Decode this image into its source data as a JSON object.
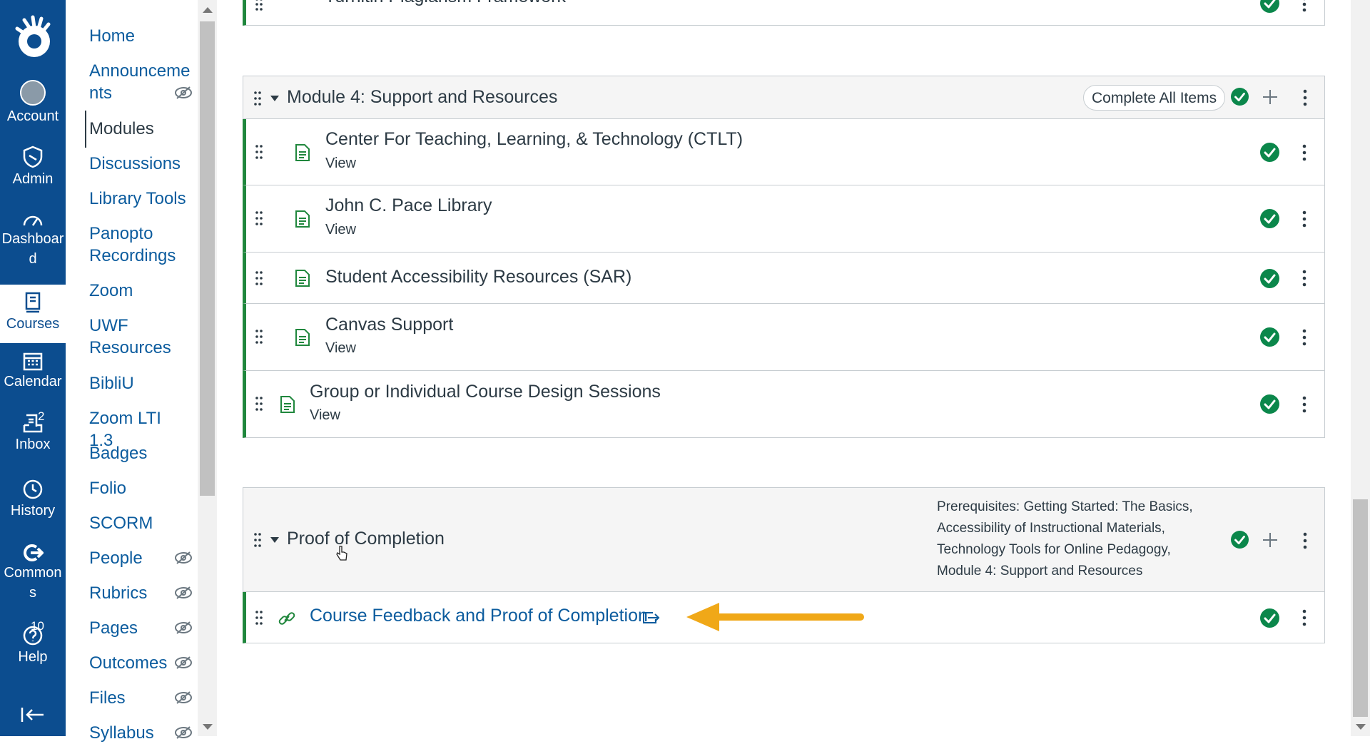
{
  "global_nav": {
    "account": "Account",
    "admin": "Admin",
    "dashboard_line1": "Dashboar",
    "dashboard_line2": "d",
    "courses": "Courses",
    "calendar": "Calendar",
    "inbox": "Inbox",
    "inbox_badge": "2",
    "history": "History",
    "commons_line1": "Common",
    "commons_line2": "s",
    "help": "Help",
    "help_badge": "10"
  },
  "course_nav": {
    "items": [
      {
        "label": "Home"
      },
      {
        "label": "Announceme",
        "label2": "nts",
        "hidden": true
      },
      {
        "label": "Modules",
        "active": true
      },
      {
        "label": "Discussions"
      },
      {
        "label": "Library Tools"
      },
      {
        "label": "Panopto",
        "label2": "Recordings"
      },
      {
        "label": "Zoom"
      },
      {
        "label": "UWF",
        "label2": "Resources"
      },
      {
        "label": "BibliU"
      },
      {
        "label": "Zoom LTI 1.3"
      },
      {
        "label": "Badges"
      },
      {
        "label": "Folio"
      },
      {
        "label": "SCORM"
      },
      {
        "label": "People",
        "hidden": true
      },
      {
        "label": "Rubrics",
        "hidden": true
      },
      {
        "label": "Pages",
        "hidden": true
      },
      {
        "label": "Outcomes",
        "hidden": true
      },
      {
        "label": "Files",
        "hidden": true
      },
      {
        "label": "Syllabus",
        "hidden": true
      }
    ]
  },
  "prev_module": {
    "last_item_title": "Turnitin Plagiarism Framework"
  },
  "module4": {
    "title": "Module 4: Support and Resources",
    "requirement": "Complete All Items",
    "items": [
      {
        "title": "Center For Teaching, Learning, & Technology (CTLT)",
        "sub": "View"
      },
      {
        "title": "John C. Pace Library",
        "sub": "View"
      },
      {
        "title": "Student Accessibility Resources (SAR)",
        "sub": ""
      },
      {
        "title": "Canvas Support",
        "sub": "View"
      },
      {
        "title": "Group or Individual Course Design Sessions",
        "sub": "View"
      }
    ]
  },
  "proof_module": {
    "title": "Proof of Completion",
    "prerequisites": [
      "Prerequisites: Getting Started: The Basics,",
      "Accessibility of Instructional Materials,",
      "Technology Tools for Online Pedagogy,",
      "Module 4: Support and Resources"
    ],
    "item_title": "Course Feedback and Proof of Completion"
  },
  "colors": {
    "nav_bg": "#0c4d8f",
    "link": "#0c5c9e",
    "complete_green": "#0b874b",
    "module_border_green": "#20873d",
    "arrow": "#f0a818"
  }
}
